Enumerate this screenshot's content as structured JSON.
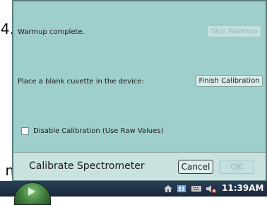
{
  "background": {
    "top_glyph": "4.",
    "bottom_glyph": "n"
  },
  "dialog": {
    "warmup_text": "Warmup complete.",
    "skip_warmup_label": "Skip Warmup",
    "instruction_text": "Place a blank cuvette in the device:",
    "finish_calibration_label": "Finish Calibration",
    "disable_calibration_label": "Disable Calibration (Use Raw Values)",
    "disable_calibration_checked": false,
    "footer_title": "Calibrate Spectrometer",
    "cancel_label": "Cancel",
    "ok_label": "OK"
  },
  "taskbar": {
    "clock": "11:39AM",
    "tray_icons": [
      "home-icon",
      "grid-icon",
      "keyboard-icon",
      "speaker-muted-icon"
    ]
  },
  "colors": {
    "dialog_bg": "#9fcfcc",
    "footer_bg": "#c9e2e0",
    "taskbar_bg": "#1f3147"
  }
}
